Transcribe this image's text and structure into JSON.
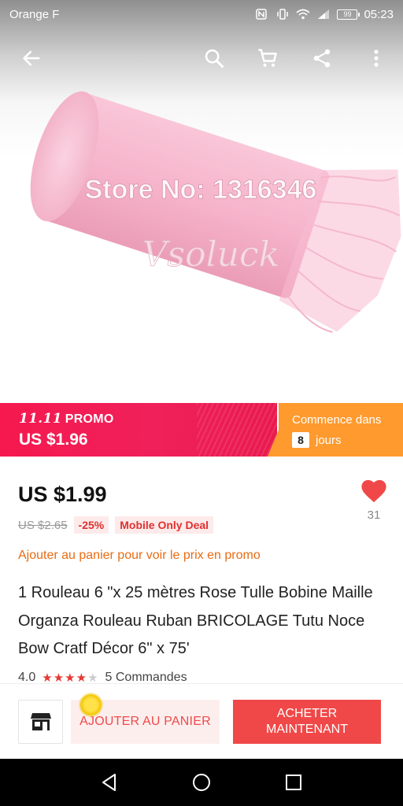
{
  "status_bar": {
    "carrier": "Orange F",
    "time": "05:23",
    "battery": "99"
  },
  "toolbar": {
    "icons": [
      "back-arrow-icon",
      "search-icon",
      "cart-icon",
      "share-icon",
      "more-vert-icon"
    ]
  },
  "hero": {
    "watermark_store": "Store No: 1316346",
    "watermark_brand": "Vsoluck"
  },
  "promo": {
    "event_brand": "11.11",
    "event_label": "PROMO",
    "promo_price": "US $1.96",
    "starts_label": "Commence dans",
    "days_value": "8",
    "days_unit": "jours"
  },
  "product": {
    "price": "US $1.99",
    "old_price": "US $2.65",
    "discount": "-25%",
    "mobile_deal": "Mobile Only Deal",
    "wishlist_count": "31",
    "promo_note": "Ajouter au panier pour voir le prix en promo",
    "title": "1 Rouleau 6 \"x 25 mètres Rose Tulle Bobine Maille Organza Rouleau Ruban BRICOLAGE Tutu Noce Bow Cratf Décor 6\" x 75'",
    "rating": "4.0",
    "rating_stars": 4,
    "orders": "5 Commandes"
  },
  "actions": {
    "add_to_cart": "AJOUTER AU PANIER",
    "buy_line1": "ACHETER",
    "buy_line2": "MAINTENANT"
  },
  "colors": {
    "promo_pink": "#f5194f",
    "promo_orange": "#ff9a2e",
    "accent_red": "#f04848",
    "note_orange": "#e86b14"
  }
}
